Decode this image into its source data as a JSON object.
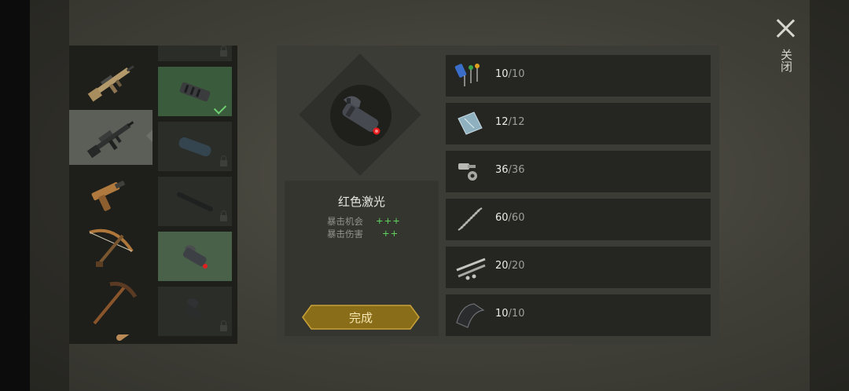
{
  "close": {
    "label": "关闭"
  },
  "weapons": [
    {
      "name": "assault-rifle"
    },
    {
      "name": "m16-rifle",
      "selected": true
    },
    {
      "name": "flare-pistol"
    },
    {
      "name": "crossbow"
    },
    {
      "name": "pickaxe"
    },
    {
      "name": "melee-bat"
    }
  ],
  "attachments": [
    {
      "name": "top-slot",
      "state": "locked"
    },
    {
      "name": "muzzle-brake",
      "state": "equipped"
    },
    {
      "name": "suppressor",
      "state": "locked"
    },
    {
      "name": "long-barrel",
      "state": "locked"
    },
    {
      "name": "red-laser",
      "state": "selected"
    },
    {
      "name": "scope-mount",
      "state": "locked"
    }
  ],
  "item": {
    "name": "红色激光",
    "stats": [
      {
        "label": "暴击机会",
        "value": "+++"
      },
      {
        "label": "暴击伤害",
        "value": "++"
      }
    ],
    "action": "完成"
  },
  "materials": [
    {
      "icon": "electronics-icon",
      "have": "10",
      "need": "/10"
    },
    {
      "icon": "glass-plate-icon",
      "have": "12",
      "need": "/12"
    },
    {
      "icon": "bolts-icon",
      "have": "36",
      "need": "/36"
    },
    {
      "icon": "spring-icon",
      "have": "60",
      "need": "/60"
    },
    {
      "icon": "metal-rods-icon",
      "have": "20",
      "need": "/20"
    },
    {
      "icon": "sheet-metal-icon",
      "have": "10",
      "need": "/10"
    }
  ]
}
